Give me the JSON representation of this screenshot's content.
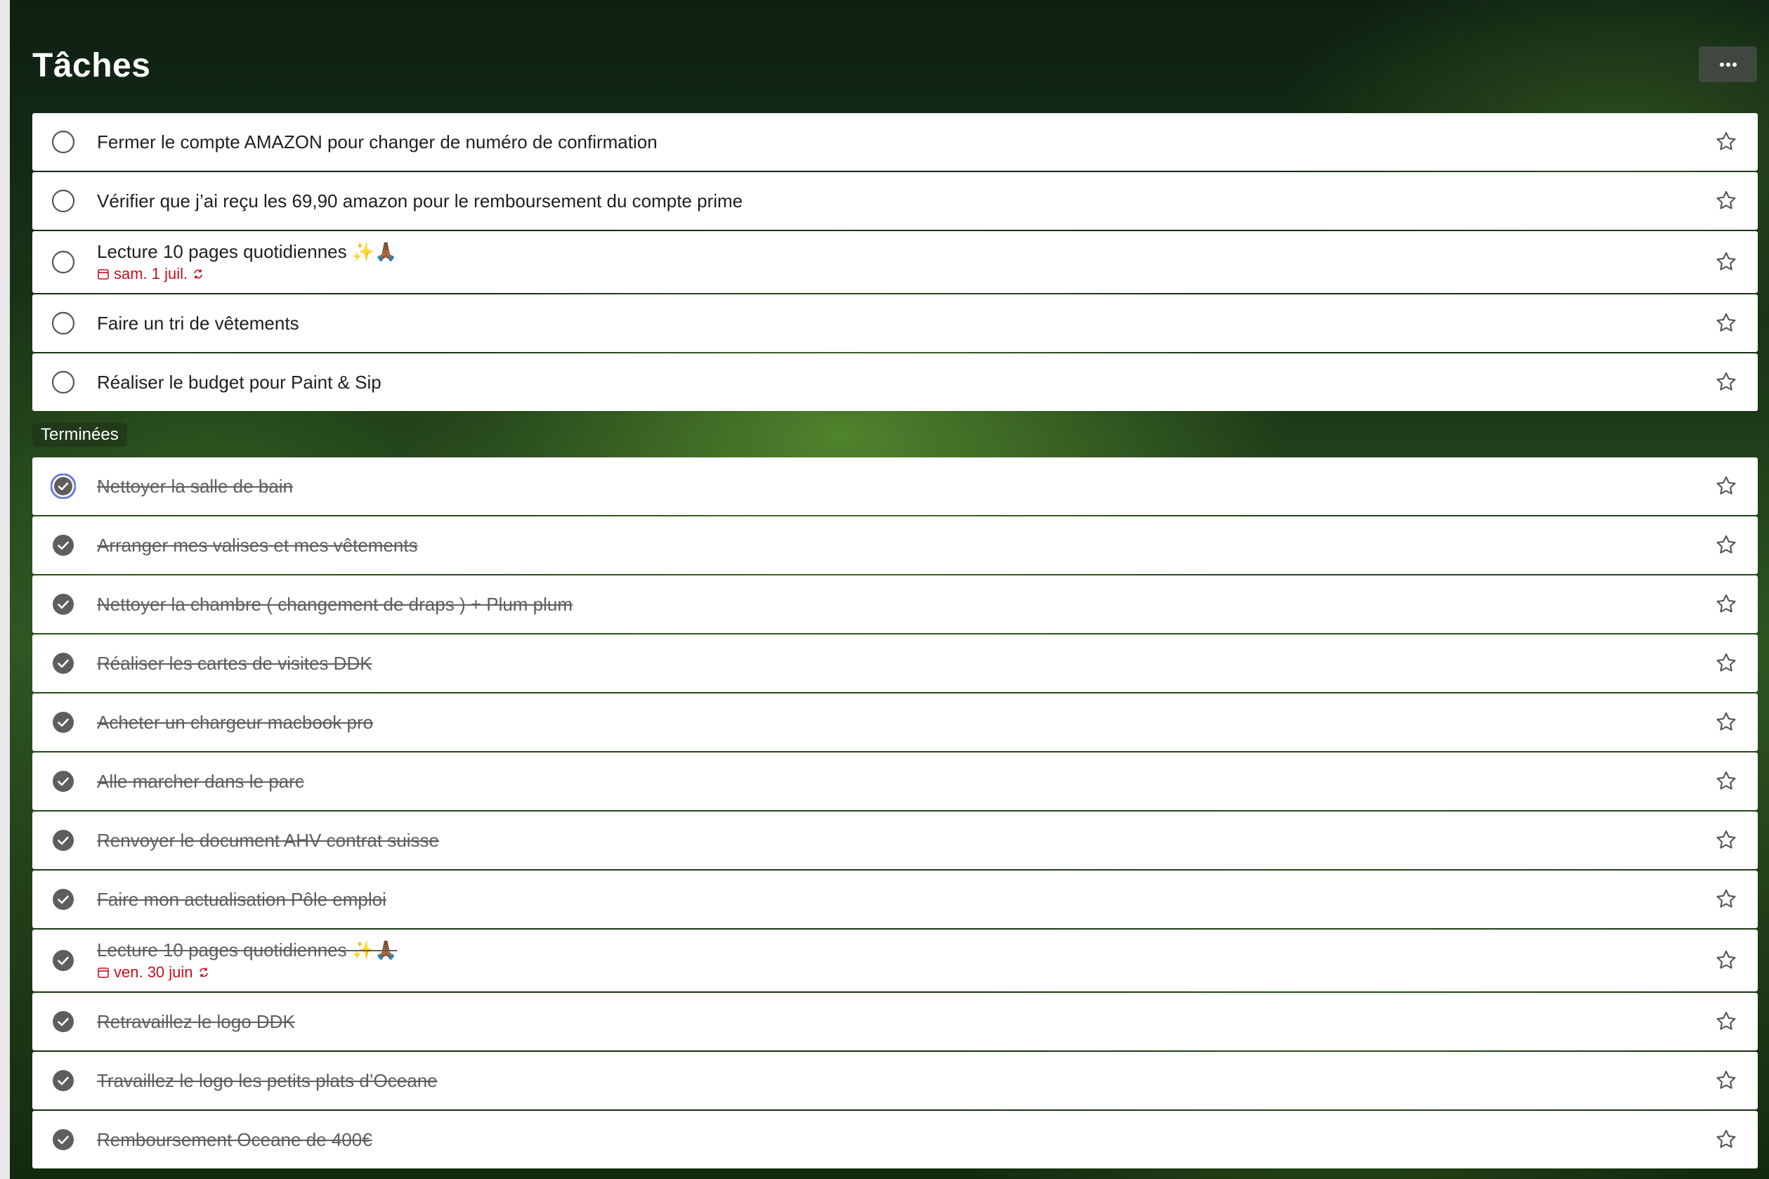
{
  "header": {
    "title": "Tâches",
    "more_label": "..."
  },
  "colors": {
    "accent": "#6b7be0",
    "due": "#c50f1f",
    "check_done": "#5e5e5e"
  },
  "active_tasks": [
    {
      "title": "Fermer le compte AMAZON pour changer de numéro de confirmation"
    },
    {
      "title": "Vérifier que j’ai reçu les 69,90 amazon pour le remboursement du compte prime"
    },
    {
      "title": "Lecture 10 pages quotidiennes ✨🙏🏾",
      "due": "sam. 1 juil."
    },
    {
      "title": "Faire un tri de vêtements"
    },
    {
      "title": "Réaliser le budget pour Paint & Sip"
    }
  ],
  "completed_section_label": "Terminées",
  "completed_tasks": [
    {
      "title": "Nettoyer la salle de bain"
    },
    {
      "title": "Arranger mes valises et mes vêtements"
    },
    {
      "title": "Nettoyer la chambre ( changement de draps ) + Plum plum"
    },
    {
      "title": "Réaliser les cartes de visites DDK"
    },
    {
      "title": "Acheter un chargeur macbook pro"
    },
    {
      "title": "Alle marcher dans le parc"
    },
    {
      "title": "Renvoyer le document AHV contrat suisse"
    },
    {
      "title": "Faire mon actualisation Pôle emploi"
    },
    {
      "title": "Lecture 10 pages quotidiennes ✨🙏🏾",
      "due": "ven. 30 juin"
    },
    {
      "title": "Retravaillez le logo DDK"
    },
    {
      "title": "Travaillez le logo les petits plats d’Oceane"
    },
    {
      "title": "Remboursement Oceane de 400€"
    }
  ]
}
